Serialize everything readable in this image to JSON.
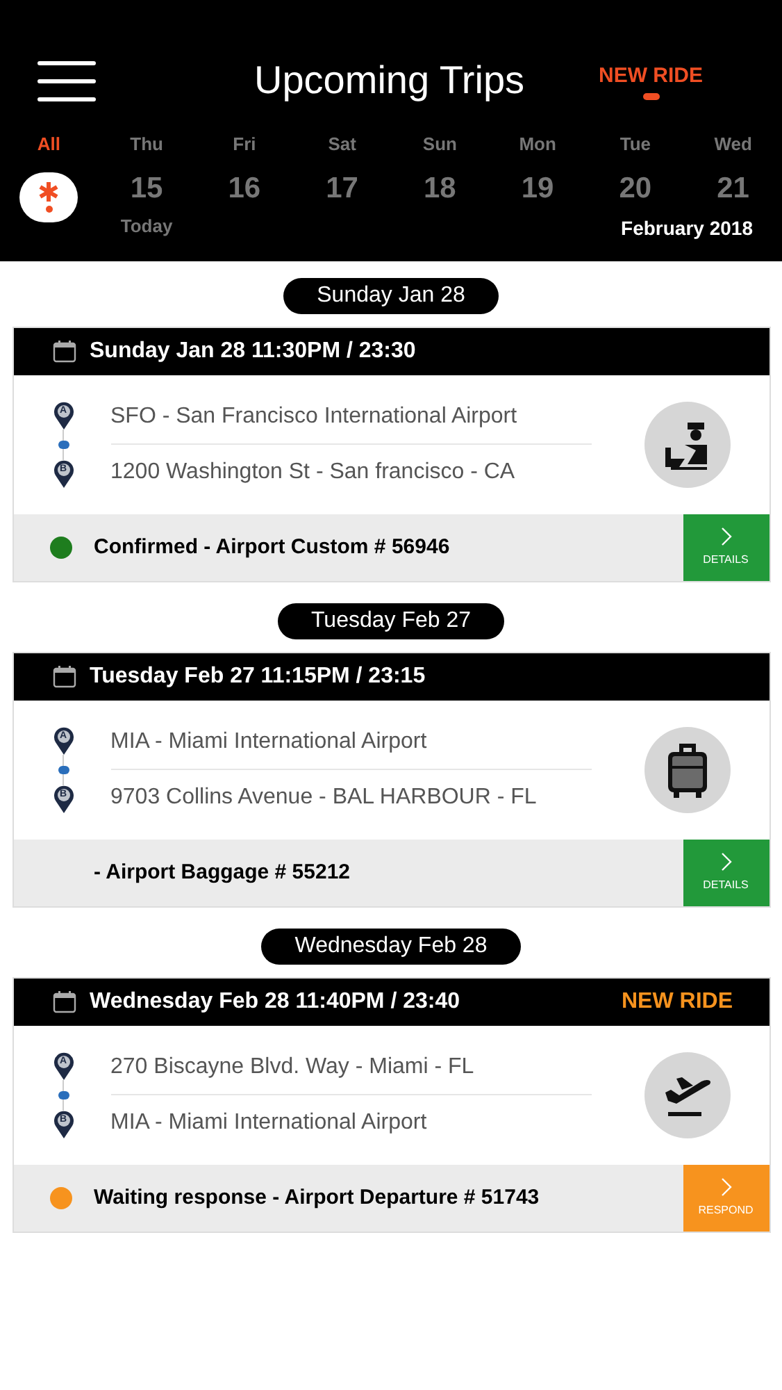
{
  "header": {
    "title": "Upcoming Trips",
    "new_ride": "NEW RIDE"
  },
  "days": [
    {
      "kind": "all",
      "weekday": "All",
      "selected": true
    },
    {
      "kind": "date",
      "weekday": "Thu",
      "date": "15",
      "note": "Today",
      "selected": false
    },
    {
      "kind": "date",
      "weekday": "Fri",
      "date": "16",
      "selected": false
    },
    {
      "kind": "date",
      "weekday": "Sat",
      "date": "17",
      "selected": false
    },
    {
      "kind": "date",
      "weekday": "Sun",
      "date": "18",
      "selected": false
    },
    {
      "kind": "date",
      "weekday": "Mon",
      "date": "19",
      "selected": false
    },
    {
      "kind": "date",
      "weekday": "Tue",
      "date": "20",
      "selected": false
    },
    {
      "kind": "date",
      "weekday": "Wed",
      "date": "21",
      "selected": false
    }
  ],
  "month": "February 2018",
  "trips": [
    {
      "heading": "Sunday Jan 28",
      "datetime": "Sunday Jan 28 11:30PM / 23:30",
      "stops": [
        {
          "pin": "A",
          "address": "SFO - San Francisco International Airport"
        },
        {
          "pin": "B",
          "address": "1200 Washington St - San francisco - CA"
        }
      ],
      "kind": "customs",
      "status": "Confirmed - Airport Custom # 56946",
      "color": "#1e7d1e",
      "action": {
        "kind": "details",
        "label": "DETAILS"
      }
    },
    {
      "heading": "Tuesday Feb 27",
      "datetime": "Tuesday Feb 27 11:15PM / 23:15",
      "stops": [
        {
          "pin": "A",
          "address": "MIA - Miami International Airport"
        },
        {
          "pin": "B",
          "address": "9703 Collins Avenue - BAL HARBOUR - FL"
        }
      ],
      "kind": "baggage",
      "status": "- Airport Baggage # 55212",
      "action": {
        "kind": "details",
        "label": "DETAILS"
      }
    },
    {
      "heading": "Wednesday Feb 28",
      "datetime": "Wednesday Feb 28 11:40PM / 23:40",
      "badge": "NEW RIDE",
      "stops": [
        {
          "pin": "A",
          "address": "270 Biscayne Blvd. Way - Miami - FL"
        },
        {
          "pin": "B",
          "address": "MIA - Miami International Airport"
        }
      ],
      "kind": "departure",
      "status": "Waiting response - Airport Departure # 51743",
      "color": "#f7931e",
      "action": {
        "kind": "respond",
        "label": "RESPOND"
      }
    }
  ]
}
